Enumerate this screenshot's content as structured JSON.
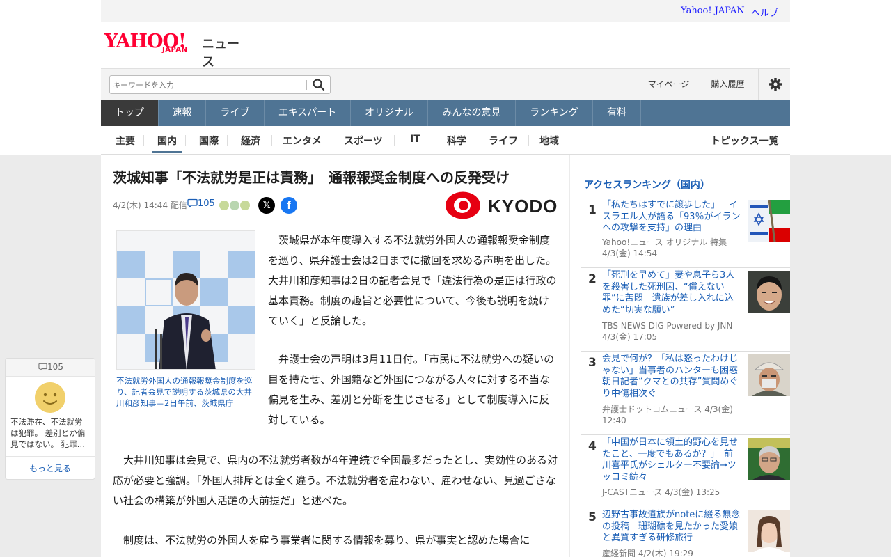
{
  "topbar": {
    "yahoo_japan": "Yahoo! JAPAN",
    "help": "ヘルプ"
  },
  "logo": {
    "yahoo": "YAHOO!",
    "japan": "JAPAN",
    "news": "ニュース"
  },
  "search": {
    "placeholder": "キーワードを入力"
  },
  "account": {
    "mypage": "マイページ",
    "history": "購入履歴"
  },
  "main_nav": [
    "トップ",
    "速報",
    "ライブ",
    "エキスパート",
    "オリジナル",
    "みんなの意見",
    "ランキング",
    "有料"
  ],
  "sub_nav": [
    "主要",
    "国内",
    "国際",
    "経済",
    "エンタメ",
    "スポーツ",
    "IT",
    "科学",
    "ライフ",
    "地域"
  ],
  "sub_nav_topics": "トピックス一覧",
  "article": {
    "title": "茨城知事「不法就労是正は責務」　通報報奨金制度への反発受け",
    "date": "4/2(木) 14:44 配信",
    "comments": "105",
    "publisher": "KYODO",
    "caption": "不法就労外国人の通報報奨金制度を巡り、記者会見で説明する茨城県の大井川和彦知事＝2日午前、茨城県庁",
    "paragraphs": [
      "　茨城県が本年度導入する不法就労外国人の通報報奨金制度を巡り、県弁護士会は2日までに撤回を求める声明を出した。大井川和彦知事は2日の記者会見で「違法行為の是正は行政の基本責務。制度の趣旨と必要性について、今後も説明を続けていく」と反論した。",
      "　弁護士会の声明は3月11日付。「市民に不法就労への疑いの目を持たせ、外国籍など外国につながる人々に対する不当な偏見を生み、差別と分断を生じさせる」として制度導入に反対している。",
      "　大井川知事は会見で、県内の不法就労者数が4年連続で全国最多だったとし、実効性のある対応が必要と強調。「外国人排斥とは全く違う。不法就労者を雇わない、雇わせない、見過ごさない社会の構築が外国人活躍の大前提だ」と述べた。",
      "　制度は、不法就労の外国人を雇う事業者に関する情報を募り、県が事実と認めた場合に"
    ]
  },
  "ranking": {
    "heading": "アクセスランキング（国内）",
    "items": [
      {
        "rank": "1",
        "title": "「私たちはすでに譲歩した」―イスラエル人が語る「93％がイランへの攻撃を支持」の理由",
        "source": "Yahoo!ニュース オリジナル 特集",
        "time": "4/3(金) 14:54"
      },
      {
        "rank": "2",
        "title": "「死刑を早めて」妻や息子ら3人を殺害した死刑囚、“償えない罪”に苦悶　遺族が差し入れに込めた“切実な願い”",
        "source": "TBS NEWS DIG Powered by JNN",
        "time": "4/3(金) 17:05"
      },
      {
        "rank": "3",
        "title": "会見で何が？「私は怒ったわけじゃない」当事者のハンターも困惑 朝日記者“クマとの共存”質問めぐり中傷相次ぐ",
        "source": "弁護士ドットコムニュース 4/3(金) 12:40",
        "time": ""
      },
      {
        "rank": "4",
        "title": "「中国が日本に領土的野心を見せたこと、一度でもあるか？」　前川喜平氏がシェルター不要論→ツッコミ続々",
        "source": "J-CASTニュース 4/3(金) 13:25",
        "time": ""
      },
      {
        "rank": "5",
        "title": "辺野古事故遺族がnoteに綴る無念の投稿　珊瑚礁を見たかった愛娘と異質すぎる研修旅行",
        "source": "産経新聞 4/2(木) 19:29",
        "time": ""
      }
    ]
  },
  "comment_float": {
    "count": "105",
    "text": "不法滞在、不法就労は犯罪。 差別とか偏見ではない。 犯罪…",
    "more": "もっと見る"
  }
}
